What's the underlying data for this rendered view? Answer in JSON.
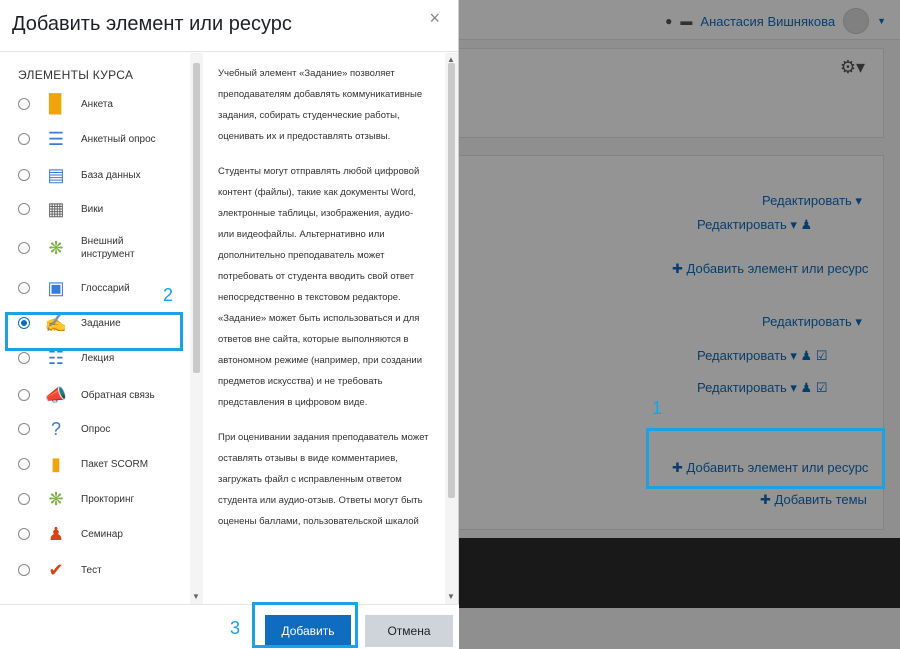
{
  "modal": {
    "title": "Добавить элемент или ресурс",
    "close_label": "×",
    "section_heading": "ЭЛЕМЕНТЫ КУРСА",
    "items": [
      {
        "label": "Анкета",
        "icon": "survey-icon",
        "selected": false
      },
      {
        "label": "Анкетный опрос",
        "icon": "questionnaire-icon",
        "selected": false
      },
      {
        "label": "База данных",
        "icon": "database-icon",
        "selected": false
      },
      {
        "label": "Вики",
        "icon": "wiki-icon",
        "selected": false
      },
      {
        "label": "Внешний инструмент",
        "icon": "external-tool-icon",
        "selected": false
      },
      {
        "label": "Глоссарий",
        "icon": "glossary-icon",
        "selected": false
      },
      {
        "label": "Задание",
        "icon": "assignment-icon",
        "selected": true
      },
      {
        "label": "Лекция",
        "icon": "lesson-icon",
        "selected": false
      },
      {
        "label": "Обратная связь",
        "icon": "feedback-icon",
        "selected": false
      },
      {
        "label": "Опрос",
        "icon": "choice-icon",
        "selected": false
      },
      {
        "label": "Пакет SCORM",
        "icon": "scorm-icon",
        "selected": false
      },
      {
        "label": "Прокторинг",
        "icon": "proctoring-icon",
        "selected": false
      },
      {
        "label": "Семинар",
        "icon": "workshop-icon",
        "selected": false
      },
      {
        "label": "Тест",
        "icon": "quiz-icon",
        "selected": false
      }
    ],
    "description": [
      "Учебный элемент «Задание» позволяет преподавателям добавлять коммуникативные задания, собирать студенческие работы, оценивать их и предоставлять отзывы.",
      "Студенты могут отправлять любой цифровой контент (файлы), такие как документы Word, электронные таблицы, изображения, аудио- или видеофайлы. Альтернативно или дополнительно преподаватель может потребовать от студента вводить свой ответ непосредственно в текстовом редакторе. «Задание» может быть использоваться и для ответов вне сайта, которые выполняются в автономном режиме (например, при создании предметов искусства) и не требовать представления в цифровом виде.",
      "При оценивании задания преподаватель может оставлять отзывы в виде комментариев, загружать файл с исправленным ответом студента или аудио-отзыв. Ответы могут быть оценены баллами, пользовательской шкалой"
    ],
    "add_button": "Добавить",
    "cancel_button": "Отмена"
  },
  "background": {
    "user_name": "Анастасия Вишнякова",
    "edit_label": "Редактировать",
    "add_activity_label": "Добавить элемент или ресурс",
    "add_topics_label": "Добавить темы"
  },
  "annotations": {
    "step1": "1",
    "step2": "2",
    "step3": "3"
  },
  "colors": {
    "accent": "#0f6cbf",
    "annotation": "#1aa1e6"
  }
}
